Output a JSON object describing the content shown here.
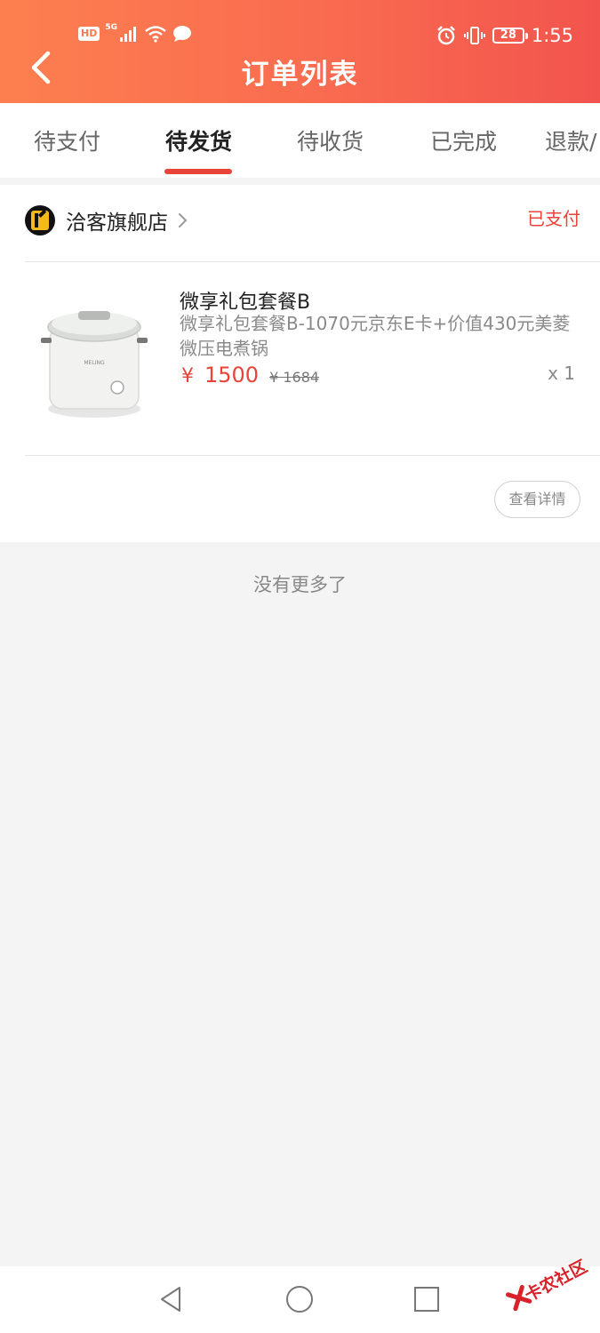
{
  "status_bar": {
    "hd_label": "HD",
    "network_label": "5G",
    "battery_level": "28",
    "time": "1:55"
  },
  "header": {
    "title": "订单列表",
    "back_icon": "chevron-left-icon"
  },
  "tabs": [
    {
      "label": "待支付",
      "active": false
    },
    {
      "label": "待发货",
      "active": true
    },
    {
      "label": "待收货",
      "active": false
    },
    {
      "label": "已完成",
      "active": false
    },
    {
      "label": "退款/",
      "active": false
    }
  ],
  "order": {
    "store_name": "洽客旗舰店",
    "status": "已支付",
    "product": {
      "title": "微享礼包套餐B",
      "description": "微享礼包套餐B-1070元京东E卡+价值430元美菱微压电煮锅",
      "currency": "¥",
      "price": "1500",
      "original_price": "¥ 1684",
      "quantity": "x 1"
    },
    "detail_button": "查看详情"
  },
  "footer_note": "没有更多了",
  "watermark": "卡农社区",
  "colors": {
    "header_gradient_start": "#fd7f4f",
    "header_gradient_end": "#f2544d",
    "accent_red": "#e8443a",
    "store_logo_yellow": "#f6b91b"
  },
  "nav_icons": [
    "back-triangle-icon",
    "home-circle-icon",
    "recents-square-icon"
  ]
}
